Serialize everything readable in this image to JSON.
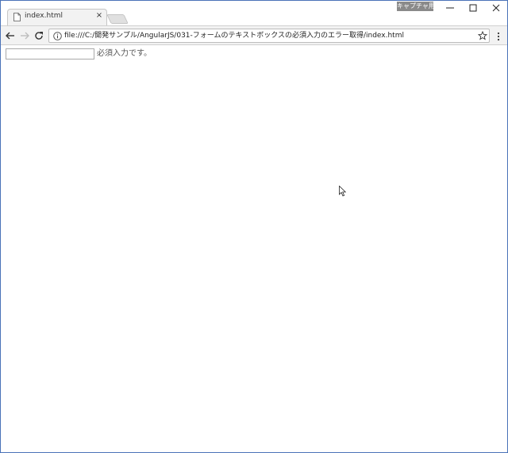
{
  "titlebar": {
    "capture_badge": "キャプチャ用"
  },
  "tab": {
    "title": "index.html",
    "close_glyph": "×"
  },
  "toolbar": {
    "url": "file:///C:/開発サンプル/AngularJS/031-フォームのテキストボックスの必須入力のエラー取得/index.html"
  },
  "page": {
    "input_value": "",
    "required_message": "必須入力です。"
  },
  "colors": {
    "window_border": "#4a72b8",
    "toolbar_bg": "#f2f2f2",
    "badge_bg": "#8a8a8a"
  }
}
